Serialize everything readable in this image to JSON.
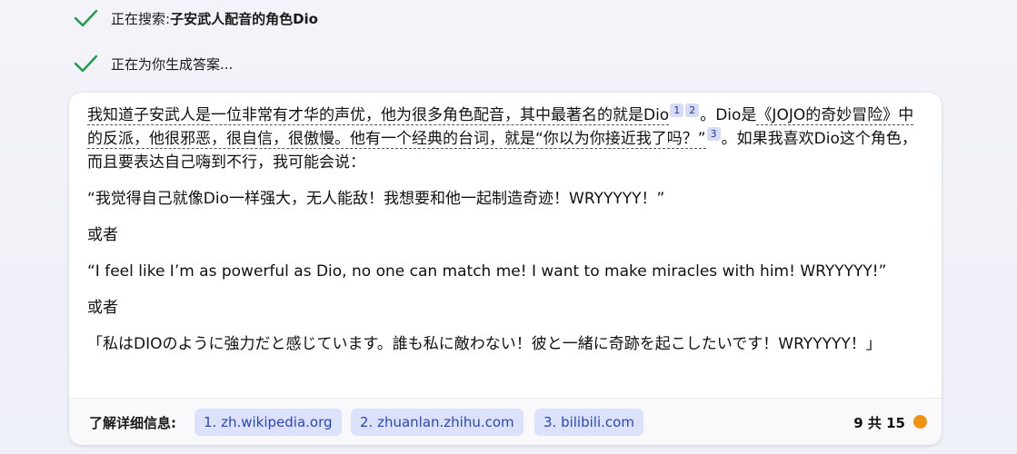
{
  "status": {
    "searching_label": "正在搜索: ",
    "searching_query": "子安武人配音的角色Dio",
    "generating_label": "正在为你生成答案..."
  },
  "answer": {
    "p1_ul_a": "我知道子安武人是一位非常有才华的声优，他为很多角色配音，其中最著名的就是Dio",
    "ref1": "1",
    "ref2": "2",
    "p1_mid": "。Dio是",
    "p1_ul_b": "《JOJO的奇妙冒险》中的反派，他很邪恶，很自信，很傲慢。他有一个经典的台词，就是“你以为你接近我了吗？”",
    "ref3": "3",
    "p1_end": "。如果我喜欢Dio这个角色，而且要表达自己嗨到不行，我可能会说：",
    "quote_zh": "“我觉得自己就像Dio一样强大，无人能敌！我想要和他一起制造奇迹！WRYYYYY！”",
    "or1": "或者",
    "quote_en": "“I feel like I’m as powerful as Dio, no one can match me! I want to make miracles with him! WRYYYYY!”",
    "or2": "或者",
    "quote_ja": "「私はDIOのように強力だと感じています。誰も私に敵わない！彼と一緒に奇跡を起こしたいです！WRYYYYY！」"
  },
  "footer": {
    "learn_more": "了解详细信息:",
    "links": [
      "1. zh.wikipedia.org",
      "2. zhuanlan.zhihu.com",
      "3. bilibili.com"
    ],
    "counter": "9 共 15",
    "status_dot_color": "#f0940f"
  },
  "colors": {
    "check": "#1f9a4a",
    "link_bg": "#dce2fb",
    "link_text": "#2b47b9"
  }
}
